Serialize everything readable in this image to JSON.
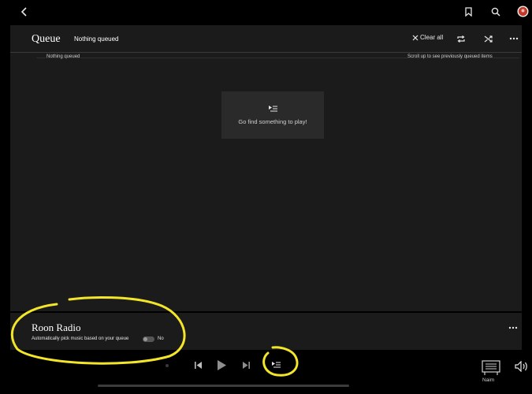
{
  "header": {
    "back_icon": "chevron-left-icon",
    "bookmark_icon": "bookmark-icon",
    "search_icon": "search-icon",
    "avatar_icon": "avatar"
  },
  "queue": {
    "title": "Queue",
    "status": "Nothing queued",
    "clear_all_label": "Clear all",
    "subheader_left": "Nothing queued",
    "subheader_right": "Scroll up to see previously queued items",
    "empty_message": "Go find something to play!"
  },
  "radio": {
    "title": "Roon Radio",
    "description": "Automatically pick music based on your queue",
    "toggle_label": "No",
    "enabled": false
  },
  "player": {
    "zone_name": "Naim"
  },
  "colors": {
    "background": "#000000",
    "panel": "#1b1b1b",
    "annotation": "#f3e62a",
    "avatar_red": "#c0392b"
  }
}
